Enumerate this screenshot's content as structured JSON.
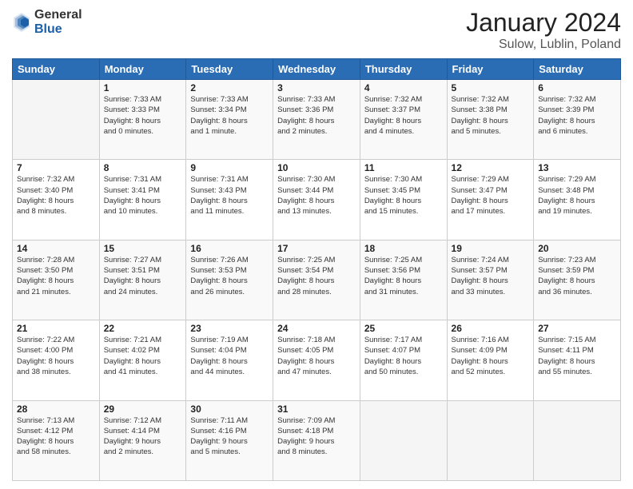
{
  "logo": {
    "general": "General",
    "blue": "Blue"
  },
  "header": {
    "title": "January 2024",
    "subtitle": "Sulow, Lublin, Poland"
  },
  "weekdays": [
    "Sunday",
    "Monday",
    "Tuesday",
    "Wednesday",
    "Thursday",
    "Friday",
    "Saturday"
  ],
  "weeks": [
    [
      {
        "day": "",
        "info": ""
      },
      {
        "day": "1",
        "info": "Sunrise: 7:33 AM\nSunset: 3:33 PM\nDaylight: 8 hours\nand 0 minutes."
      },
      {
        "day": "2",
        "info": "Sunrise: 7:33 AM\nSunset: 3:34 PM\nDaylight: 8 hours\nand 1 minute."
      },
      {
        "day": "3",
        "info": "Sunrise: 7:33 AM\nSunset: 3:36 PM\nDaylight: 8 hours\nand 2 minutes."
      },
      {
        "day": "4",
        "info": "Sunrise: 7:32 AM\nSunset: 3:37 PM\nDaylight: 8 hours\nand 4 minutes."
      },
      {
        "day": "5",
        "info": "Sunrise: 7:32 AM\nSunset: 3:38 PM\nDaylight: 8 hours\nand 5 minutes."
      },
      {
        "day": "6",
        "info": "Sunrise: 7:32 AM\nSunset: 3:39 PM\nDaylight: 8 hours\nand 6 minutes."
      }
    ],
    [
      {
        "day": "7",
        "info": "Sunrise: 7:32 AM\nSunset: 3:40 PM\nDaylight: 8 hours\nand 8 minutes."
      },
      {
        "day": "8",
        "info": "Sunrise: 7:31 AM\nSunset: 3:41 PM\nDaylight: 8 hours\nand 10 minutes."
      },
      {
        "day": "9",
        "info": "Sunrise: 7:31 AM\nSunset: 3:43 PM\nDaylight: 8 hours\nand 11 minutes."
      },
      {
        "day": "10",
        "info": "Sunrise: 7:30 AM\nSunset: 3:44 PM\nDaylight: 8 hours\nand 13 minutes."
      },
      {
        "day": "11",
        "info": "Sunrise: 7:30 AM\nSunset: 3:45 PM\nDaylight: 8 hours\nand 15 minutes."
      },
      {
        "day": "12",
        "info": "Sunrise: 7:29 AM\nSunset: 3:47 PM\nDaylight: 8 hours\nand 17 minutes."
      },
      {
        "day": "13",
        "info": "Sunrise: 7:29 AM\nSunset: 3:48 PM\nDaylight: 8 hours\nand 19 minutes."
      }
    ],
    [
      {
        "day": "14",
        "info": "Sunrise: 7:28 AM\nSunset: 3:50 PM\nDaylight: 8 hours\nand 21 minutes."
      },
      {
        "day": "15",
        "info": "Sunrise: 7:27 AM\nSunset: 3:51 PM\nDaylight: 8 hours\nand 24 minutes."
      },
      {
        "day": "16",
        "info": "Sunrise: 7:26 AM\nSunset: 3:53 PM\nDaylight: 8 hours\nand 26 minutes."
      },
      {
        "day": "17",
        "info": "Sunrise: 7:25 AM\nSunset: 3:54 PM\nDaylight: 8 hours\nand 28 minutes."
      },
      {
        "day": "18",
        "info": "Sunrise: 7:25 AM\nSunset: 3:56 PM\nDaylight: 8 hours\nand 31 minutes."
      },
      {
        "day": "19",
        "info": "Sunrise: 7:24 AM\nSunset: 3:57 PM\nDaylight: 8 hours\nand 33 minutes."
      },
      {
        "day": "20",
        "info": "Sunrise: 7:23 AM\nSunset: 3:59 PM\nDaylight: 8 hours\nand 36 minutes."
      }
    ],
    [
      {
        "day": "21",
        "info": "Sunrise: 7:22 AM\nSunset: 4:00 PM\nDaylight: 8 hours\nand 38 minutes."
      },
      {
        "day": "22",
        "info": "Sunrise: 7:21 AM\nSunset: 4:02 PM\nDaylight: 8 hours\nand 41 minutes."
      },
      {
        "day": "23",
        "info": "Sunrise: 7:19 AM\nSunset: 4:04 PM\nDaylight: 8 hours\nand 44 minutes."
      },
      {
        "day": "24",
        "info": "Sunrise: 7:18 AM\nSunset: 4:05 PM\nDaylight: 8 hours\nand 47 minutes."
      },
      {
        "day": "25",
        "info": "Sunrise: 7:17 AM\nSunset: 4:07 PM\nDaylight: 8 hours\nand 50 minutes."
      },
      {
        "day": "26",
        "info": "Sunrise: 7:16 AM\nSunset: 4:09 PM\nDaylight: 8 hours\nand 52 minutes."
      },
      {
        "day": "27",
        "info": "Sunrise: 7:15 AM\nSunset: 4:11 PM\nDaylight: 8 hours\nand 55 minutes."
      }
    ],
    [
      {
        "day": "28",
        "info": "Sunrise: 7:13 AM\nSunset: 4:12 PM\nDaylight: 8 hours\nand 58 minutes."
      },
      {
        "day": "29",
        "info": "Sunrise: 7:12 AM\nSunset: 4:14 PM\nDaylight: 9 hours\nand 2 minutes."
      },
      {
        "day": "30",
        "info": "Sunrise: 7:11 AM\nSunset: 4:16 PM\nDaylight: 9 hours\nand 5 minutes."
      },
      {
        "day": "31",
        "info": "Sunrise: 7:09 AM\nSunset: 4:18 PM\nDaylight: 9 hours\nand 8 minutes."
      },
      {
        "day": "",
        "info": ""
      },
      {
        "day": "",
        "info": ""
      },
      {
        "day": "",
        "info": ""
      }
    ]
  ]
}
